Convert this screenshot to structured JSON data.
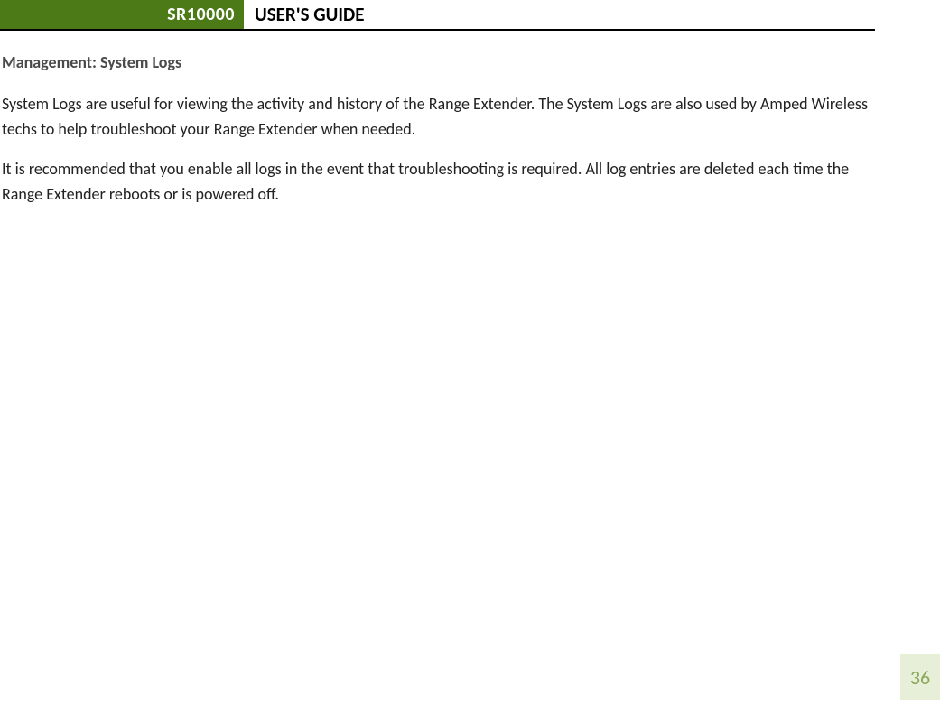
{
  "header": {
    "model": "SR10000",
    "title": "USER'S GUIDE"
  },
  "section_heading": "Management: System Logs",
  "paragraphs": [
    "System Logs are useful for viewing the activity and history of the Range Extender.  The System Logs are also used by Amped Wireless techs to help troubleshoot your Range Extender when needed.",
    "It is recommended that you enable all logs in the event that troubleshooting is required.  All log entries are deleted each time the Range Extender reboots or is powered off."
  ],
  "page_number": "36"
}
